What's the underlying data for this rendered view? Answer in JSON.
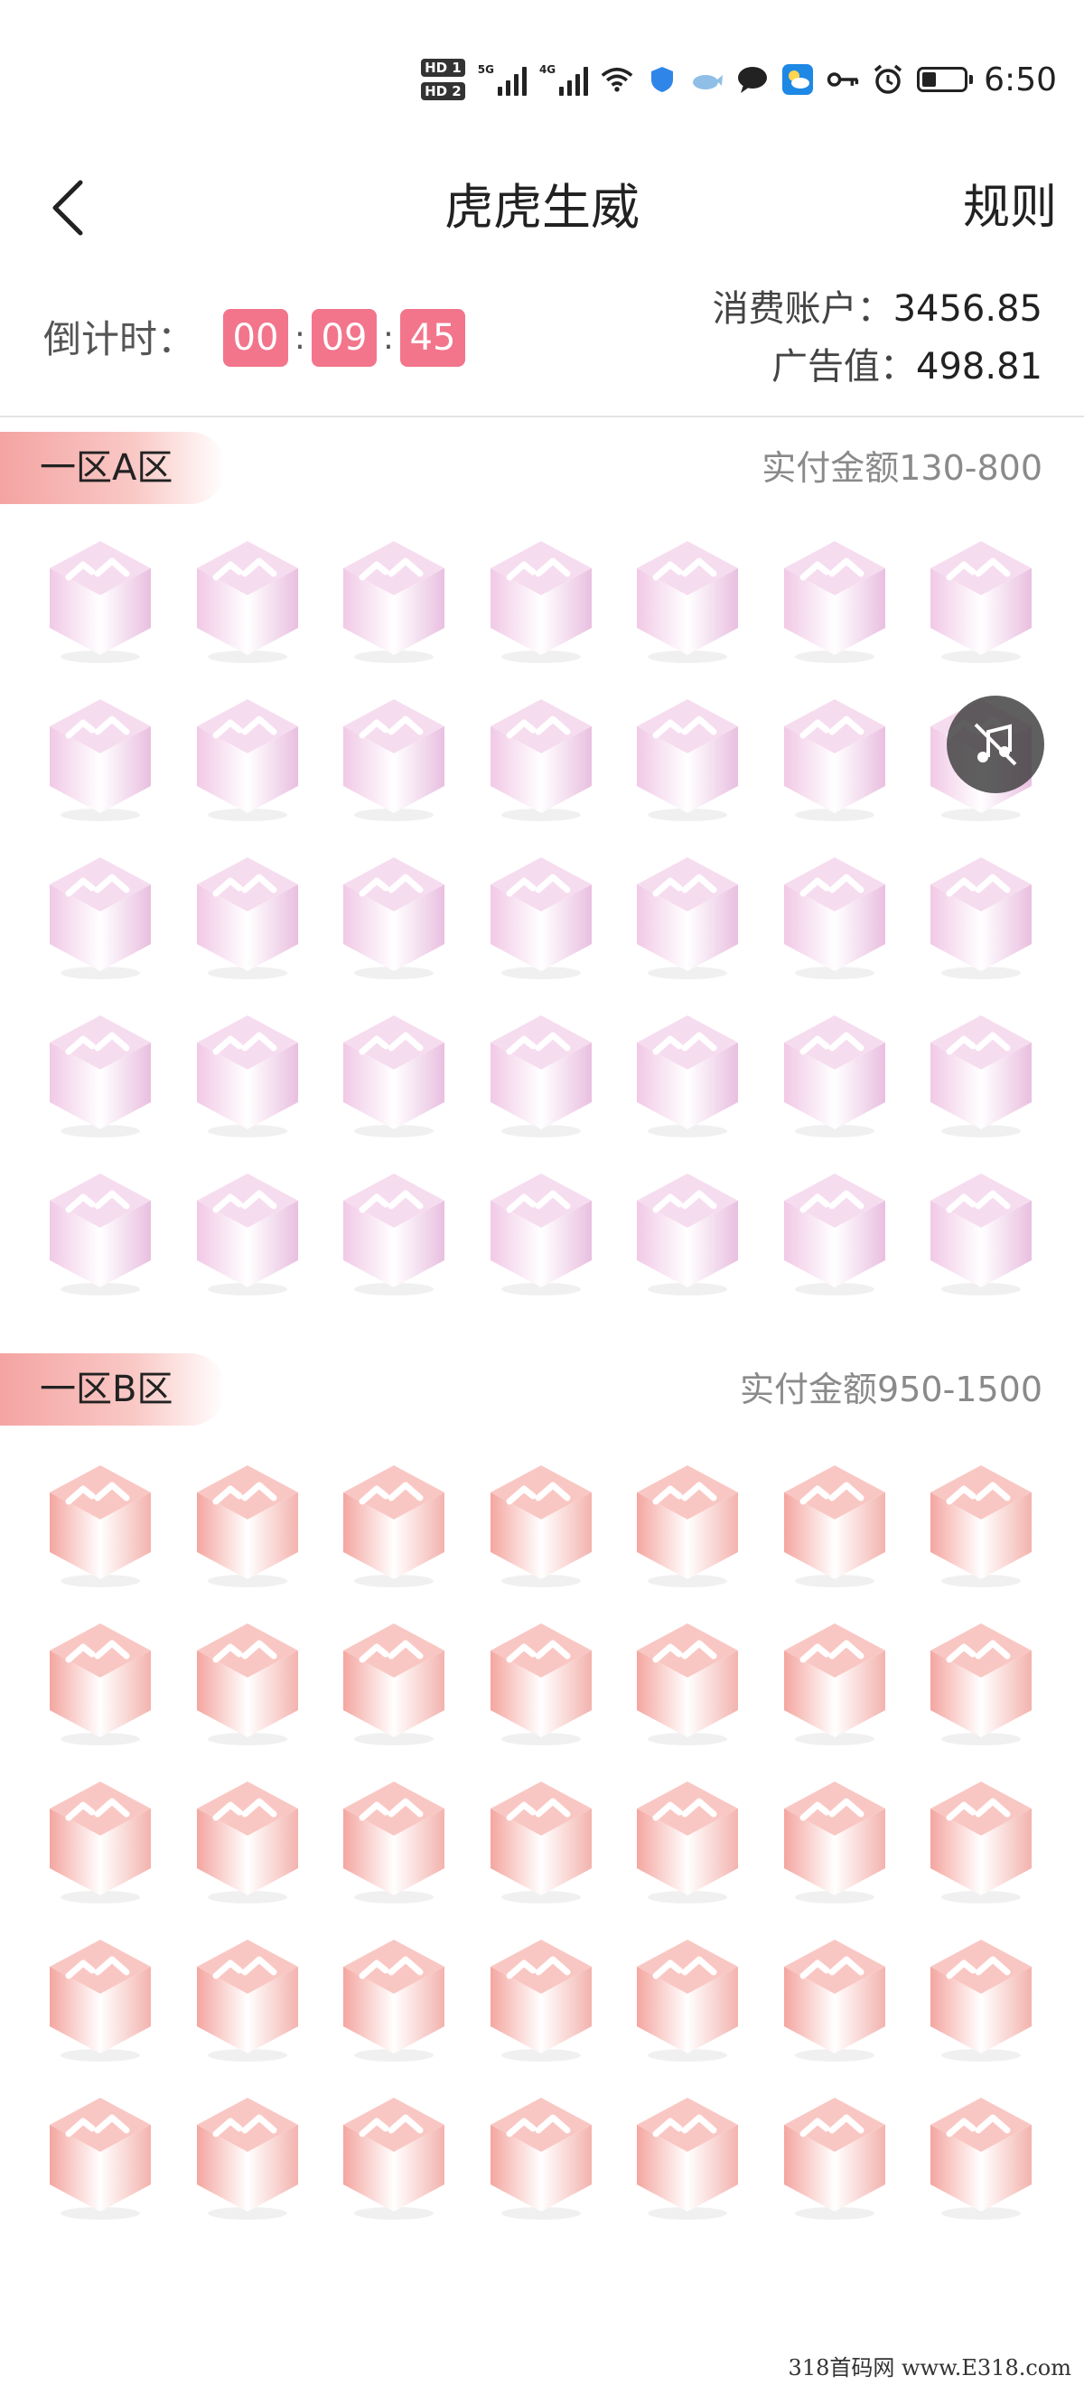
{
  "status_bar": {
    "hd1": "HD 1",
    "hd2": "HD 2",
    "signal1": "5G",
    "signal2": "4G",
    "time": "6:50"
  },
  "nav": {
    "title": "虎虎生威",
    "rules_label": "规则"
  },
  "countdown": {
    "label": "倒计时：",
    "hours": "00",
    "minutes": "09",
    "seconds": "45",
    "sep": ":"
  },
  "account": {
    "consume_label": "消费账户：",
    "consume_value": "3456.85",
    "ad_label": "广告值：",
    "ad_value": "498.81"
  },
  "zones": [
    {
      "name": "一区A区",
      "range": "实付金额130-800",
      "rows": 5,
      "cols": 7,
      "color_top": "#f6dcef",
      "color_left": "#f1c9e6",
      "color_right": "#e9bfe0"
    },
    {
      "name": "一区B区",
      "range": "实付金额950-1500",
      "rows": 5,
      "cols": 7,
      "color_top": "#f9c7c3",
      "color_left": "#f4a6a0",
      "color_right": "#f3b3ae"
    }
  ],
  "watermark": "318首码网 www.E318.com",
  "colors": {
    "countdown_bg": "#f2758c",
    "zone_tag": "#f4a4a2"
  },
  "icons": {
    "back": "chevron-left-icon",
    "music": "music-off-icon"
  }
}
